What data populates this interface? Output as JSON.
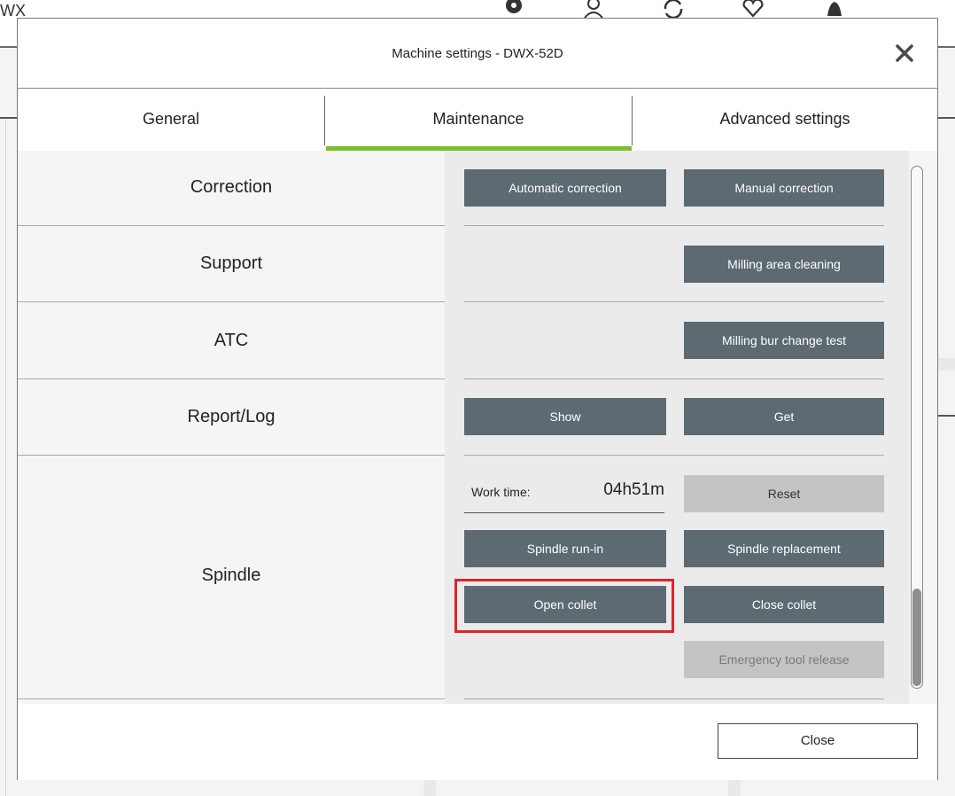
{
  "background": {
    "app_title": "WX",
    "icons": [
      "gear-icon",
      "user-icon",
      "refresh-icon",
      "heart-icon",
      "bell-icon"
    ]
  },
  "dialog": {
    "title": "Machine settings - DWX-52D",
    "close_icon": "close-icon"
  },
  "tabs": [
    {
      "label": "General",
      "active": false
    },
    {
      "label": "Maintenance",
      "active": true
    },
    {
      "label": "Advanced settings",
      "active": false
    }
  ],
  "accent_color": "#7bbf2a",
  "highlight_color": "#e32228",
  "sections": {
    "correction": {
      "label": "Correction",
      "buttons": [
        "Automatic correction",
        "Manual correction"
      ]
    },
    "support": {
      "label": "Support",
      "buttons": [
        "Milling area cleaning"
      ]
    },
    "atc": {
      "label": "ATC",
      "buttons": [
        "Milling bur change test"
      ]
    },
    "report_log": {
      "label": "Report/Log",
      "buttons": [
        "Show",
        "Get"
      ]
    },
    "spindle": {
      "label": "Spindle",
      "work_time_label": "Work time:",
      "work_time_value": "04h51m",
      "reset": "Reset",
      "spindle_run_in": "Spindle run-in",
      "spindle_replacement": "Spindle replacement",
      "open_collet": "Open collet",
      "close_collet": "Close collet",
      "emergency_tool_release": "Emergency tool release"
    }
  },
  "footer": {
    "close_label": "Close"
  }
}
